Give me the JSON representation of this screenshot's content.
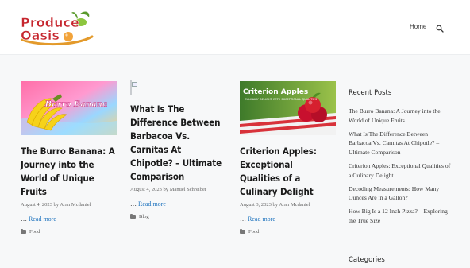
{
  "header": {
    "logo_text": "Produce Oasis",
    "nav_home": "Home",
    "search_icon": "search-icon"
  },
  "posts": [
    {
      "image_caption": "Burro Banana",
      "title": "The Burro Banana: A Journey into the World of Unique Fruits",
      "date": "August 4, 2023",
      "by": "by",
      "author": "Aran Mcdaniel",
      "excerpt_prefix": "…",
      "read_more": "Read more",
      "category": "Food"
    },
    {
      "title": "What Is The Difference Between Barbacoa Vs. Carnitas At Chipotle? – Ultimate Comparison",
      "date": "August 4, 2023",
      "by": "by",
      "author": "Manuel Schreiber",
      "excerpt_prefix": "…",
      "read_more": "Read more",
      "category": "Blog"
    },
    {
      "image_caption": "Criterion Apples",
      "image_subcaption": "CULINARY DELIGHT WITH EXCEPTIONAL QUALITIES",
      "title": "Criterion Apples: Exceptional Qualities of a Culinary Delight",
      "date": "August 3, 2023",
      "by": "by",
      "author": "Aran Mcdaniel",
      "excerpt_prefix": "…",
      "read_more": "Read more",
      "category": "Food"
    }
  ],
  "sidebar": {
    "recent_title": "Recent Posts",
    "recent_posts": [
      "The Burro Banana: A Journey into the World of Unique Fruits",
      "What Is The Difference Between Barbacoa Vs. Carnitas At Chipotle? – Ultimate Comparison",
      "Criterion Apples: Exceptional Qualities of a Culinary Delight",
      "Decoding Measurements: How Many Ounces Are in a Gallon?",
      "How Big Is a 12 Inch Pizza? – Exploring the True Size"
    ],
    "categories_title": "Categories"
  },
  "colors": {
    "link": "#1e73be",
    "logo_red": "#c6262e",
    "logo_green": "#5a9a2c"
  }
}
